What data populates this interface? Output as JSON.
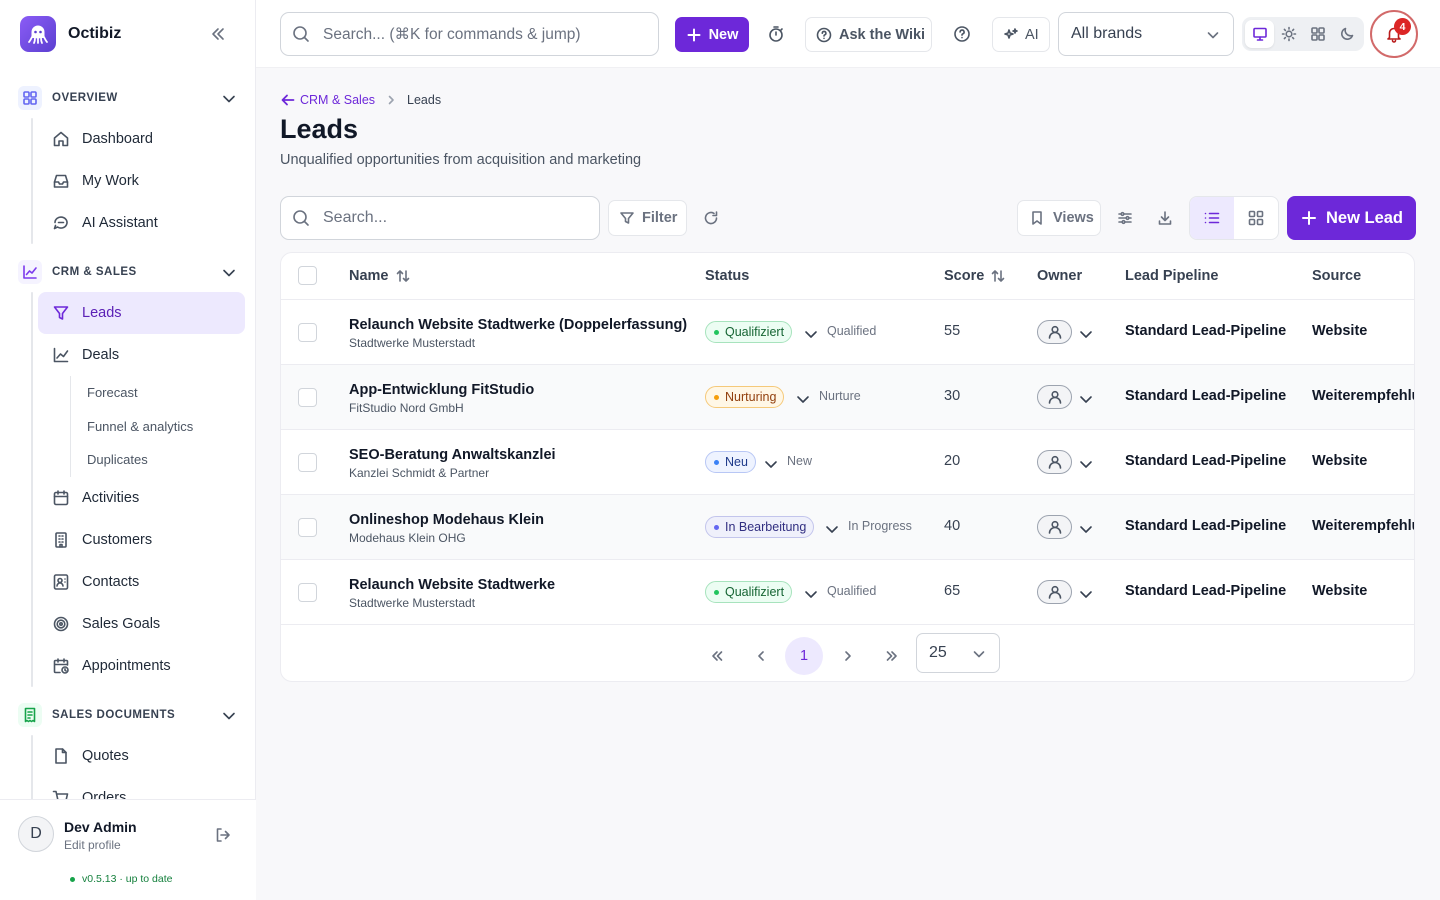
{
  "app": {
    "name": "Octibiz"
  },
  "sidebar": {
    "sections": [
      {
        "label": "OVERVIEW",
        "items": [
          {
            "label": "Dashboard",
            "icon": "home-icon"
          },
          {
            "label": "My Work",
            "icon": "inbox-icon"
          },
          {
            "label": "AI Assistant",
            "icon": "chat-icon"
          }
        ]
      },
      {
        "label": "CRM & SALES",
        "items": [
          {
            "label": "Leads",
            "icon": "funnel-icon",
            "active": true
          },
          {
            "label": "Deals",
            "icon": "chart-line-icon"
          },
          {
            "label": "Activities",
            "icon": "calendar-icon"
          },
          {
            "label": "Customers",
            "icon": "building-icon"
          },
          {
            "label": "Contacts",
            "icon": "contact-card-icon"
          },
          {
            "label": "Sales Goals",
            "icon": "target-icon"
          },
          {
            "label": "Appointments",
            "icon": "calendar-clock-icon"
          }
        ],
        "deal_subitems": [
          "Forecast",
          "Funnel & analytics",
          "Duplicates"
        ]
      },
      {
        "label": "SALES DOCUMENTS",
        "items": [
          {
            "label": "Quotes",
            "icon": "file-icon"
          },
          {
            "label": "Orders",
            "icon": "cart-icon"
          }
        ]
      }
    ],
    "user": {
      "initial": "D",
      "name": "Dev Admin",
      "sub": "Edit profile"
    },
    "version": "v0.5.13 · up to date"
  },
  "topbar": {
    "search_placeholder": "Search... (⌘K for commands & jump)",
    "new_label": "New",
    "wiki_label": "Ask the Wiki",
    "ai_label": "AI",
    "brand_select": "All brands",
    "notifications_count": "4"
  },
  "page": {
    "breadcrumb_parent": "CRM & Sales",
    "breadcrumb_current": "Leads",
    "title": "Leads",
    "subtitle": "Unqualified opportunities from acquisition and marketing"
  },
  "toolbar": {
    "search_placeholder": "Search...",
    "filter_label": "Filter",
    "views_label": "Views",
    "new_lead_label": "New Lead"
  },
  "table": {
    "columns": {
      "name": "Name",
      "status": "Status",
      "score": "Score",
      "owner": "Owner",
      "pipeline": "Lead Pipeline",
      "source": "Source"
    },
    "rows": [
      {
        "name": "Relaunch Website Stadtwerke (Doppelerfassung)",
        "company": "Stadtwerke Musterstadt",
        "status": "Qualifiziert",
        "status_en": "Qualified",
        "tone": "green",
        "score": "55",
        "pipeline": "Standard Lead-Pipeline",
        "source": "Website"
      },
      {
        "name": "App-Entwicklung FitStudio",
        "company": "FitStudio Nord GmbH",
        "status": "Nurturing",
        "status_en": "Nurture",
        "tone": "amber",
        "score": "30",
        "pipeline": "Standard Lead-Pipeline",
        "source": "Weiterempfehlung"
      },
      {
        "name": "SEO-Beratung Anwaltskanzlei",
        "company": "Kanzlei Schmidt & Partner",
        "status": "Neu",
        "status_en": "New",
        "tone": "blue",
        "score": "20",
        "pipeline": "Standard Lead-Pipeline",
        "source": "Website"
      },
      {
        "name": "Onlineshop Modehaus Klein",
        "company": "Modehaus Klein OHG",
        "status": "In Bearbeitung",
        "status_en": "In Progress",
        "tone": "indigo",
        "score": "40",
        "pipeline": "Standard Lead-Pipeline",
        "source": "Weiterempfehlung"
      },
      {
        "name": "Relaunch Website Stadtwerke",
        "company": "Stadtwerke Musterstadt",
        "status": "Qualifiziert",
        "status_en": "Qualified",
        "tone": "green",
        "score": "65",
        "pipeline": "Standard Lead-Pipeline",
        "source": "Website"
      }
    ]
  },
  "pagination": {
    "current_page": "1",
    "page_size": "25"
  },
  "colors": {
    "accent": "#6d28d9",
    "accent_soft": "#ede9fe"
  }
}
